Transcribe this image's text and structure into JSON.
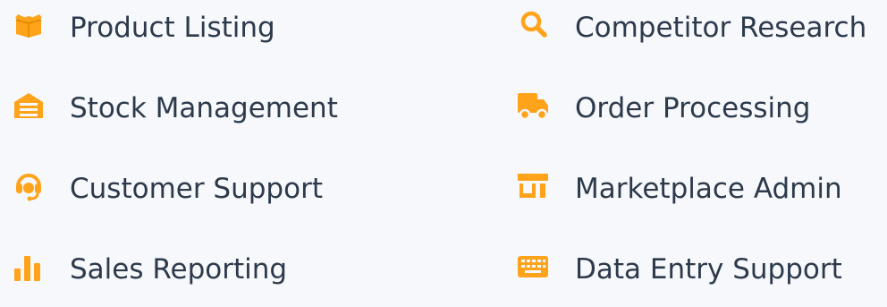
{
  "accent_color": "#ffa31a",
  "text_color": "#2d3a4c",
  "items": [
    {
      "label": "Product Listing",
      "icon": "box-icon"
    },
    {
      "label": "Competitor Research",
      "icon": "search-icon"
    },
    {
      "label": "Stock Management",
      "icon": "warehouse-icon"
    },
    {
      "label": "Order Processing",
      "icon": "truck-icon"
    },
    {
      "label": "Customer Support",
      "icon": "headset-icon"
    },
    {
      "label": "Marketplace Admin",
      "icon": "store-icon"
    },
    {
      "label": "Sales Reporting",
      "icon": "bar-chart-icon"
    },
    {
      "label": "Data Entry Support",
      "icon": "keyboard-icon"
    }
  ]
}
